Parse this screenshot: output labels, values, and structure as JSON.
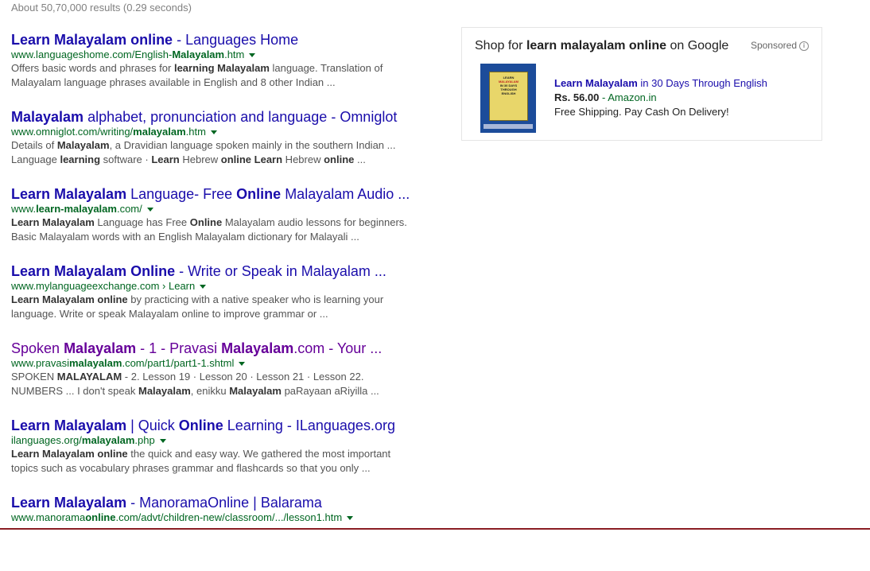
{
  "stats": "About 50,70,000 results (0.29 seconds)",
  "results": [
    {
      "title": [
        {
          "t": "Learn Malayalam online",
          "b": true
        },
        {
          "t": " - Languages Home",
          "b": false
        }
      ],
      "url": [
        {
          "t": "www.languageshome.com/English-",
          "b": false
        },
        {
          "t": "Malayalam",
          "b": true
        },
        {
          "t": ".htm",
          "b": false
        }
      ],
      "snippet1": [
        {
          "t": "Offers basic words and phrases for ",
          "b": false
        },
        {
          "t": "learning Malayalam",
          "b": true
        },
        {
          "t": " language. Translation of",
          "b": false
        }
      ],
      "snippet2": [
        {
          "t": "Malayalam language phrases available in English and 8 other Indian ...",
          "b": false
        }
      ],
      "visited": false
    },
    {
      "title": [
        {
          "t": "Malayalam",
          "b": true
        },
        {
          "t": " alphabet, pronunciation and language - Omniglot",
          "b": false
        }
      ],
      "url": [
        {
          "t": "www.omniglot.com/writing/",
          "b": false
        },
        {
          "t": "malayalam",
          "b": true
        },
        {
          "t": ".htm",
          "b": false
        }
      ],
      "snippet1": [
        {
          "t": "Details of ",
          "b": false
        },
        {
          "t": "Malayalam",
          "b": true
        },
        {
          "t": ", a Dravidian language spoken mainly in the southern Indian ...",
          "b": false
        }
      ],
      "snippet2": [
        {
          "t": "Language ",
          "b": false
        },
        {
          "t": "learning",
          "b": true
        },
        {
          "t": " software · ",
          "b": false
        },
        {
          "t": "Learn",
          "b": true
        },
        {
          "t": " Hebrew ",
          "b": false
        },
        {
          "t": "online Learn",
          "b": true
        },
        {
          "t": " Hebrew ",
          "b": false
        },
        {
          "t": "online",
          "b": true
        },
        {
          "t": " ...",
          "b": false
        }
      ],
      "visited": false
    },
    {
      "title": [
        {
          "t": "Learn Malayalam",
          "b": true
        },
        {
          "t": " Language- Free ",
          "b": false
        },
        {
          "t": "Online",
          "b": true
        },
        {
          "t": " Malayalam Audio ...",
          "b": false
        }
      ],
      "url": [
        {
          "t": "www.",
          "b": false
        },
        {
          "t": "learn-malayalam",
          "b": true
        },
        {
          "t": ".com/",
          "b": false
        }
      ],
      "snippet1": [
        {
          "t": "Learn Malayalam",
          "b": true
        },
        {
          "t": " Language has Free ",
          "b": false
        },
        {
          "t": "Online",
          "b": true
        },
        {
          "t": " Malayalam audio lessons for beginners.",
          "b": false
        }
      ],
      "snippet2": [
        {
          "t": "Basic Malayalam words with an English Malayalam dictionary for Malayali ...",
          "b": false
        }
      ],
      "visited": false
    },
    {
      "title": [
        {
          "t": "Learn Malayalam Online",
          "b": true
        },
        {
          "t": " - Write or Speak in Malayalam ...",
          "b": false
        }
      ],
      "url": [
        {
          "t": "www.mylanguageexchange.com › Learn",
          "b": false
        }
      ],
      "snippet1": [
        {
          "t": "Learn Malayalam online",
          "b": true
        },
        {
          "t": " by practicing with a native speaker who is learning your",
          "b": false
        }
      ],
      "snippet2": [
        {
          "t": "language. Write or speak Malayalam online to improve grammar or ...",
          "b": false
        }
      ],
      "visited": false
    },
    {
      "title": [
        {
          "t": "Spoken ",
          "b": false
        },
        {
          "t": "Malayalam",
          "b": true
        },
        {
          "t": " - 1 - Pravasi ",
          "b": false
        },
        {
          "t": "Malayalam",
          "b": true
        },
        {
          "t": ".com - Your ...",
          "b": false
        }
      ],
      "url": [
        {
          "t": "www.pravasi",
          "b": false
        },
        {
          "t": "malayalam",
          "b": true
        },
        {
          "t": ".com/part1/part1-1.shtml",
          "b": false
        }
      ],
      "snippet1": [
        {
          "t": "SPOKEN ",
          "b": false
        },
        {
          "t": "MALAYALAM",
          "b": true
        },
        {
          "t": " - 2. Lesson 19 · Lesson 20 · Lesson 21 · Lesson 22.",
          "b": false
        }
      ],
      "snippet2": [
        {
          "t": "NUMBERS ... I don't speak ",
          "b": false
        },
        {
          "t": "Malayalam",
          "b": true
        },
        {
          "t": ", enikku ",
          "b": false
        },
        {
          "t": "Malayalam",
          "b": true
        },
        {
          "t": " paRayaan aRiyilla ...",
          "b": false
        }
      ],
      "visited": true
    },
    {
      "title": [
        {
          "t": "Learn Malayalam",
          "b": true
        },
        {
          "t": " | Quick ",
          "b": false
        },
        {
          "t": "Online",
          "b": true
        },
        {
          "t": " Learning - ILanguages.org",
          "b": false
        }
      ],
      "url": [
        {
          "t": "ilanguages.org/",
          "b": false
        },
        {
          "t": "malayalam",
          "b": true
        },
        {
          "t": ".php",
          "b": false
        }
      ],
      "snippet1": [
        {
          "t": "Learn Malayalam online",
          "b": true
        },
        {
          "t": " the quick and easy way. We gathered the most important",
          "b": false
        }
      ],
      "snippet2": [
        {
          "t": "topics such as vocabulary phrases grammar and flashcards so that you only ...",
          "b": false
        }
      ],
      "visited": false
    },
    {
      "title": [
        {
          "t": "Learn Malayalam",
          "b": true
        },
        {
          "t": " - ManoramaOnline | Balarama",
          "b": false
        }
      ],
      "url": [
        {
          "t": "www.manorama",
          "b": false
        },
        {
          "t": "online",
          "b": true
        },
        {
          "t": ".com/advt/children-new/classroom/.../lesson1.htm",
          "b": false
        }
      ],
      "snippet1": [],
      "snippet2": [],
      "visited": false
    }
  ],
  "ad": {
    "head_prefix": "Shop for ",
    "head_query": "learn malayalam online",
    "head_suffix": " on Google",
    "sponsored": "Sponsored",
    "info_icon": "i",
    "product_title_bold": "Learn Malayalam",
    "product_title_rest": " in 30 Days Through English",
    "price": "Rs. 56.00",
    "price_sep": " - ",
    "store": "Amazon.in",
    "shipping": "Free Shipping. Pay Cash On Delivery!",
    "book_cover_lines": [
      "LEARN",
      "MALAYALAM",
      "IN 30 DAYS",
      "THROUGH",
      "ENGLISH"
    ]
  },
  "colors": {
    "link": "#1a0dab",
    "visited": "#660099",
    "url_green": "#006621",
    "snippet": "#545454",
    "bottom_border": "#8b1e24"
  }
}
